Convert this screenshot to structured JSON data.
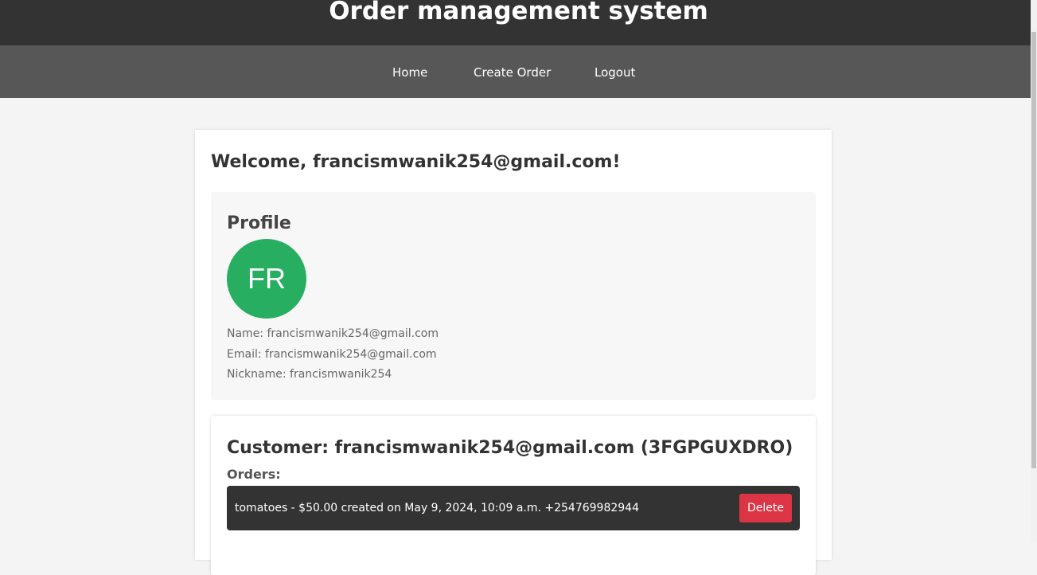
{
  "app": {
    "title": "Order management system"
  },
  "nav": {
    "items": [
      {
        "label": "Home"
      },
      {
        "label": "Create Order"
      },
      {
        "label": "Logout"
      }
    ]
  },
  "welcome": {
    "text": "Welcome, francismwanik254@gmail.com!"
  },
  "profile": {
    "heading": "Profile",
    "initials": "FR",
    "name_line": "Name: francismwanik254@gmail.com",
    "email_line": "Email: francismwanik254@gmail.com",
    "nickname_line": "Nickname: francismwanik254",
    "avatar_color": "#27ae60"
  },
  "customer": {
    "heading": "Customer: francismwanik254@gmail.com (3FGPGUXDRO)",
    "orders_label": "Orders:",
    "orders": [
      {
        "text": "tomatoes - $50.00 created on May 9, 2024, 10:09 a.m. +254769982944",
        "delete_label": "Delete"
      }
    ]
  },
  "colors": {
    "header_bg": "#333333",
    "nav_bg": "#575757",
    "delete_button": "#dc3545"
  }
}
